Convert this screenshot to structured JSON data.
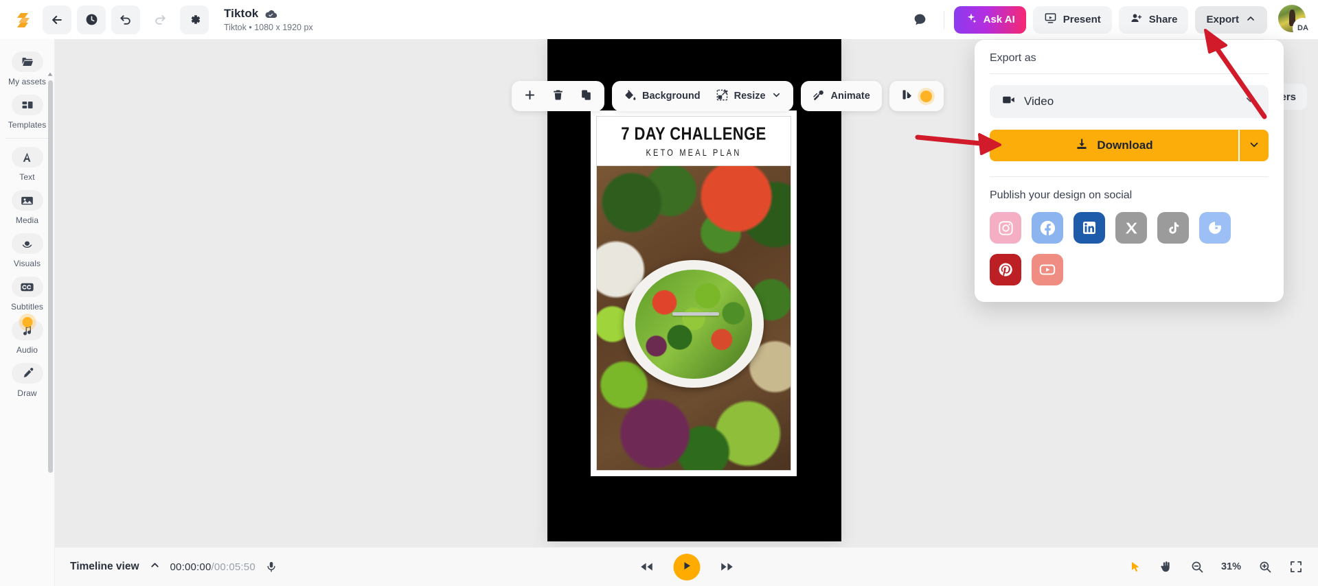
{
  "app": {
    "logo": "sendsteps-logo",
    "document": {
      "title": "Tiktok",
      "cloud_status_icon": "cloud-saved-icon",
      "subtitle": "Tiktok • 1080 x 1920 px"
    },
    "nav_buttons": [
      {
        "name": "back-button",
        "icon": "arrow-left-icon"
      },
      {
        "name": "history-button",
        "icon": "clock-icon"
      },
      {
        "name": "undo-button",
        "icon": "undo-icon"
      },
      {
        "name": "redo-button",
        "icon": "redo-icon",
        "disabled": true
      },
      {
        "name": "settings-button",
        "icon": "gear-icon"
      }
    ],
    "actions": {
      "comments_icon": "chat-bubble-icon",
      "ask_ai": "Ask AI",
      "present": "Present",
      "share": "Share",
      "export": "Export",
      "export_chevron": "chevron-up-icon",
      "avatar_initials": "DA"
    }
  },
  "sidebar": {
    "items": [
      {
        "label": "My assets",
        "icon": "folder-icon"
      },
      {
        "label": "Templates",
        "icon": "templates-grid-icon"
      },
      {
        "label": "Text",
        "icon": "text-a-icon"
      },
      {
        "label": "Media",
        "icon": "image-icon"
      },
      {
        "label": "Visuals",
        "icon": "shapes-icon"
      },
      {
        "label": "Subtitles",
        "icon": "cc-icon"
      },
      {
        "label": "Audio",
        "icon": "music-note-icon"
      },
      {
        "label": "Draw",
        "icon": "pen-icon"
      }
    ]
  },
  "element_toolbar": {
    "add": "add-icon",
    "delete": "trash-icon",
    "duplicate": "copy-icon",
    "background": "Background",
    "resize": "Resize",
    "animate": "Animate",
    "styles_icon": "color-palette-icon"
  },
  "right_panel_button": {
    "label": "Layers",
    "icon": "layers-icon"
  },
  "canvas": {
    "design": {
      "title": "7 DAY CHALLENGE",
      "subtitle": "KETO MEAL PLAN",
      "photo_description": "keto-salad-flatlay-photo"
    }
  },
  "export_panel": {
    "heading": "Export as",
    "format_select": {
      "value": "Video",
      "icon": "video-camera-icon",
      "chevron": "chevron-down-icon"
    },
    "download_button": {
      "label": "Download",
      "icon": "download-icon",
      "split_chevron": "chevron-down-icon",
      "color": "#fcad09"
    },
    "social_heading": "Publish your design on social",
    "social_networks": [
      {
        "name": "instagram",
        "label": "Instagram",
        "color": "#f5afc4"
      },
      {
        "name": "facebook",
        "label": "Facebook",
        "color": "#8cb4ef"
      },
      {
        "name": "linkedin",
        "label": "LinkedIn",
        "color": "#1f5bab"
      },
      {
        "name": "x-twitter",
        "label": "X",
        "color": "#9b9b9b"
      },
      {
        "name": "tiktok",
        "label": "TikTok",
        "color": "#9b9b9b"
      },
      {
        "name": "google",
        "label": "Google",
        "color": "#9cc0f5"
      },
      {
        "name": "pinterest",
        "label": "Pinterest",
        "color": "#bc2024"
      },
      {
        "name": "youtube",
        "label": "YouTube",
        "color": "#ef8d82"
      }
    ]
  },
  "timeline_bar": {
    "view_label": "Timeline view",
    "collapse_icon": "chevron-up-icon",
    "current_time": "00:00:00",
    "time_separator": "/",
    "total_time": "00:05:50",
    "mic_icon": "microphone-icon",
    "transport": {
      "rewind": "rewind-icon",
      "play": "play-icon",
      "forward": "fast-forward-icon"
    },
    "tools": {
      "select": "cursor-arrow-icon",
      "pan": "hand-icon",
      "zoom_out": "magnifier-minus-icon",
      "zoom_level": "31%",
      "zoom_in": "magnifier-plus-icon",
      "fit_screen": "fullscreen-icon"
    }
  },
  "annotations": {
    "arrow_color": "#d11a2a",
    "arrow_1_target": "export-button",
    "arrow_2_target": "download-button"
  }
}
